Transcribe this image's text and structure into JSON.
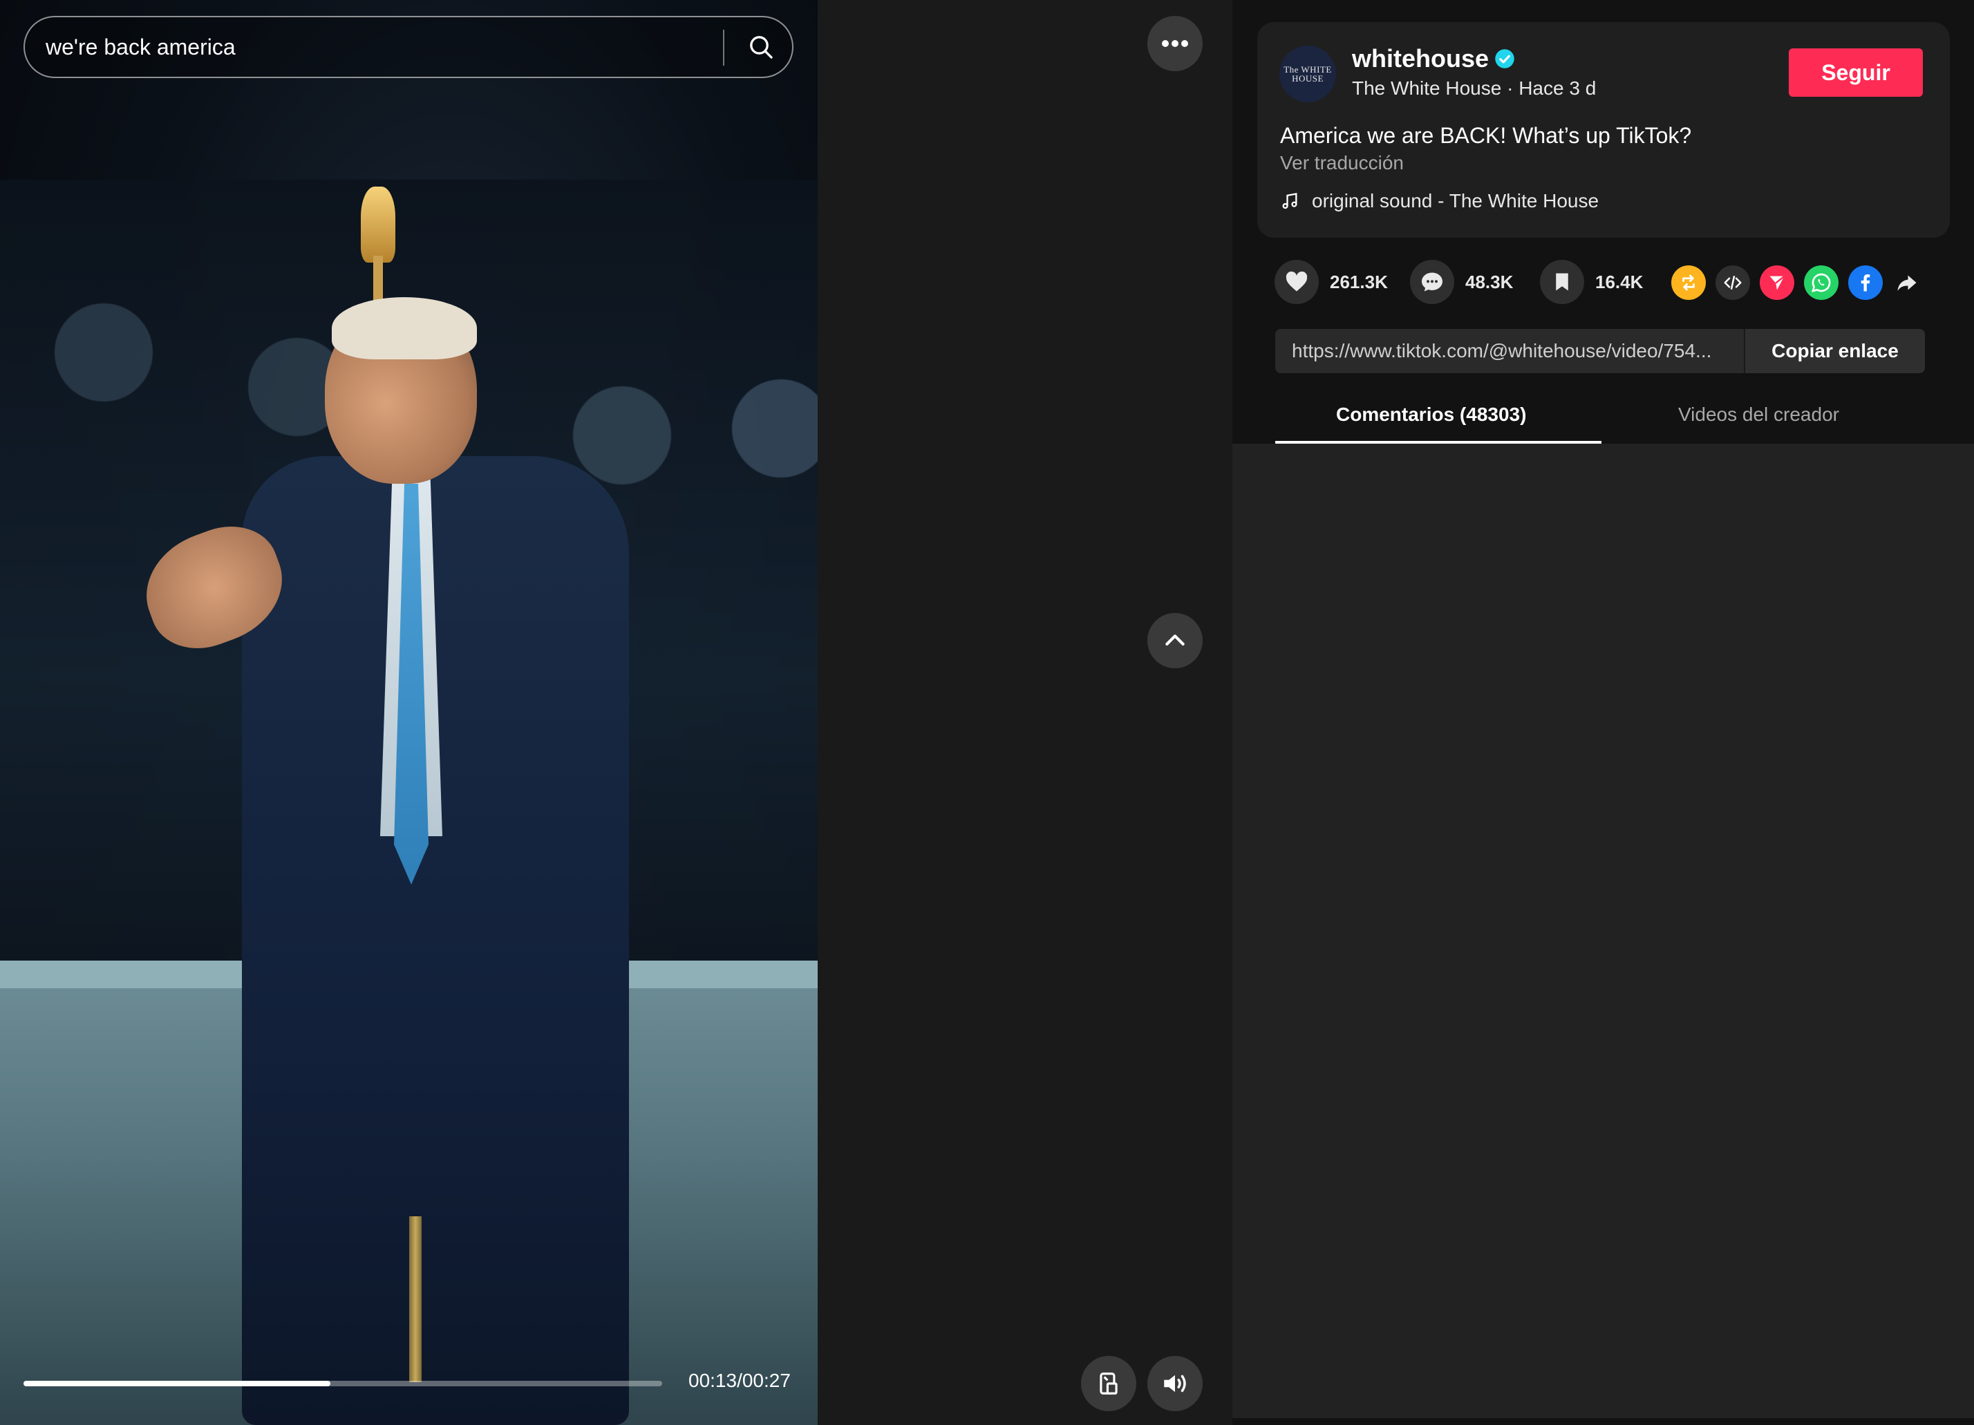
{
  "search": {
    "query": "we're back america"
  },
  "player": {
    "progress": 0.48,
    "time": "00:13/00:27"
  },
  "author": {
    "avatar_text": "The WHITE HOUSE",
    "username": "whitehouse",
    "display_name": "The White House",
    "time_ago": "Hace 3 d",
    "subline": "The White House · Hace 3 d",
    "follow_label": "Seguir"
  },
  "post": {
    "caption": "America we are BACK! What’s up TikTok?",
    "translate_label": "Ver traducción",
    "sound": "original sound - The White House"
  },
  "stats": {
    "likes": "261.3K",
    "comments": "48.3K",
    "saves": "16.4K"
  },
  "share": {
    "link": "https://www.tiktok.com/@whitehouse/video/754...",
    "copy_label": "Copiar enlace"
  },
  "tabs": [
    {
      "label": "Comentarios (48303)",
      "active": true
    },
    {
      "label": "Videos del creador",
      "active": false
    }
  ],
  "colors": {
    "follow": "#fe2c55",
    "verified": "#20d5ec",
    "repost": "#fdb41e",
    "telegram": "#fe2c55",
    "whatsapp": "#25d366",
    "facebook": "#1877f2"
  },
  "icons": [
    "search-icon",
    "more-icon",
    "chevron-up-icon",
    "mini-player-icon",
    "volume-icon",
    "heart-icon",
    "comment-icon",
    "bookmark-icon",
    "repost-icon",
    "embed-icon",
    "send-icon",
    "whatsapp-icon",
    "facebook-icon",
    "share-arrow-icon",
    "music-note-icon",
    "verified-icon"
  ]
}
